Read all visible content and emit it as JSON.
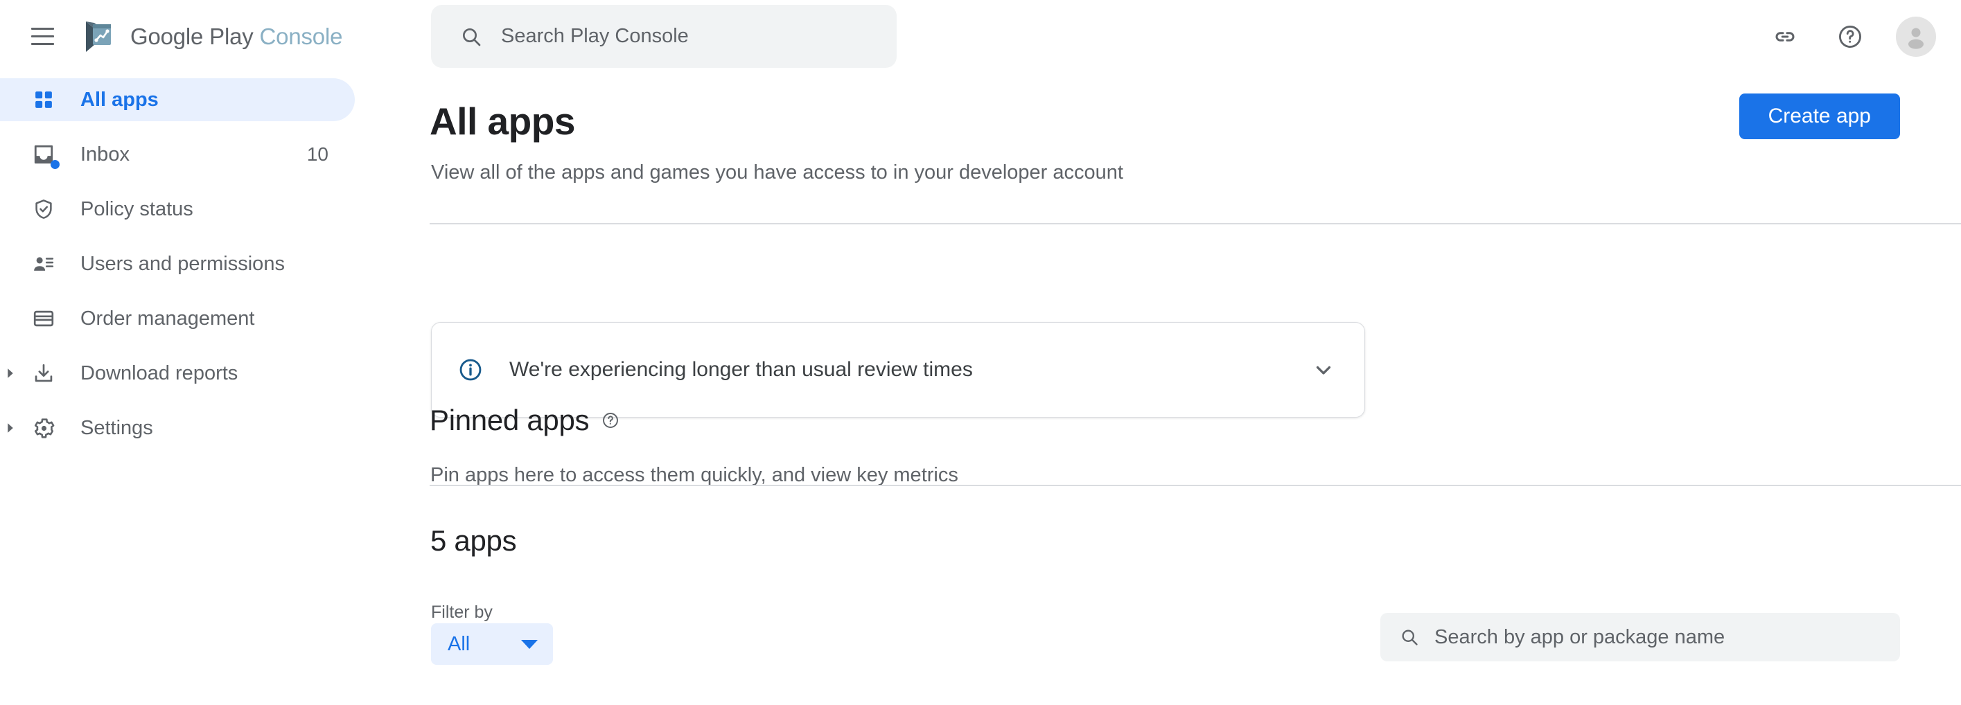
{
  "topbar": {
    "menu_icon": "hamburger-menu-icon",
    "brand_primary": "Google Play",
    "brand_secondary": "Console",
    "logo_icon": "google-play-console-logo",
    "search": {
      "placeholder": "Search Play Console",
      "value": "",
      "icon": "search-icon"
    },
    "icons": [
      {
        "name": "link-icon",
        "label": "Link"
      },
      {
        "name": "help-circle-icon",
        "label": "Help"
      },
      {
        "name": "account-avatar",
        "label": "Account"
      }
    ]
  },
  "sidebar": {
    "items": [
      {
        "label": "All apps",
        "icon": "grid-apps-icon",
        "active": true,
        "badge": "",
        "expandable": false,
        "dot": false
      },
      {
        "label": "Inbox",
        "icon": "inbox-icon",
        "active": false,
        "badge": "10",
        "expandable": false,
        "dot": true
      },
      {
        "label": "Policy status",
        "icon": "shield-check-icon",
        "active": false,
        "badge": "",
        "expandable": false,
        "dot": false
      },
      {
        "label": "Users and permissions",
        "icon": "users-permissions-icon",
        "active": false,
        "badge": "",
        "expandable": false,
        "dot": false
      },
      {
        "label": "Order management",
        "icon": "credit-card-icon",
        "active": false,
        "badge": "",
        "expandable": false,
        "dot": false
      },
      {
        "label": "Download reports",
        "icon": "download-icon",
        "active": false,
        "badge": "",
        "expandable": true,
        "dot": false
      },
      {
        "label": "Settings",
        "icon": "gear-icon",
        "active": false,
        "badge": "",
        "expandable": true,
        "dot": false
      }
    ]
  },
  "main": {
    "title": "All apps",
    "subtitle": "View all of the apps and games you have access to in your developer account",
    "create_button": "Create app",
    "banner": {
      "icon": "info-circle-icon",
      "text": "We're experiencing longer than usual review times",
      "chevron": "chevron-down-icon"
    },
    "pinned": {
      "title": "Pinned apps",
      "help_icon": "help-circle-icon",
      "subtitle": "Pin apps here to access them quickly, and view key metrics"
    },
    "apps_count": "5 apps",
    "filter": {
      "label": "Filter by",
      "value": "All",
      "caret": "chevron-down-icon"
    },
    "app_search": {
      "placeholder": "Search by app or package name",
      "value": "",
      "icon": "search-icon"
    }
  },
  "colors": {
    "accent_blue": "#1a73e8",
    "accent_blue_bg": "#e8f0fe",
    "text_primary": "#202124",
    "text_secondary": "#5f6368",
    "divider": "#dadce0",
    "field_bg": "#f1f3f4",
    "info_blue": "#185a8c"
  }
}
